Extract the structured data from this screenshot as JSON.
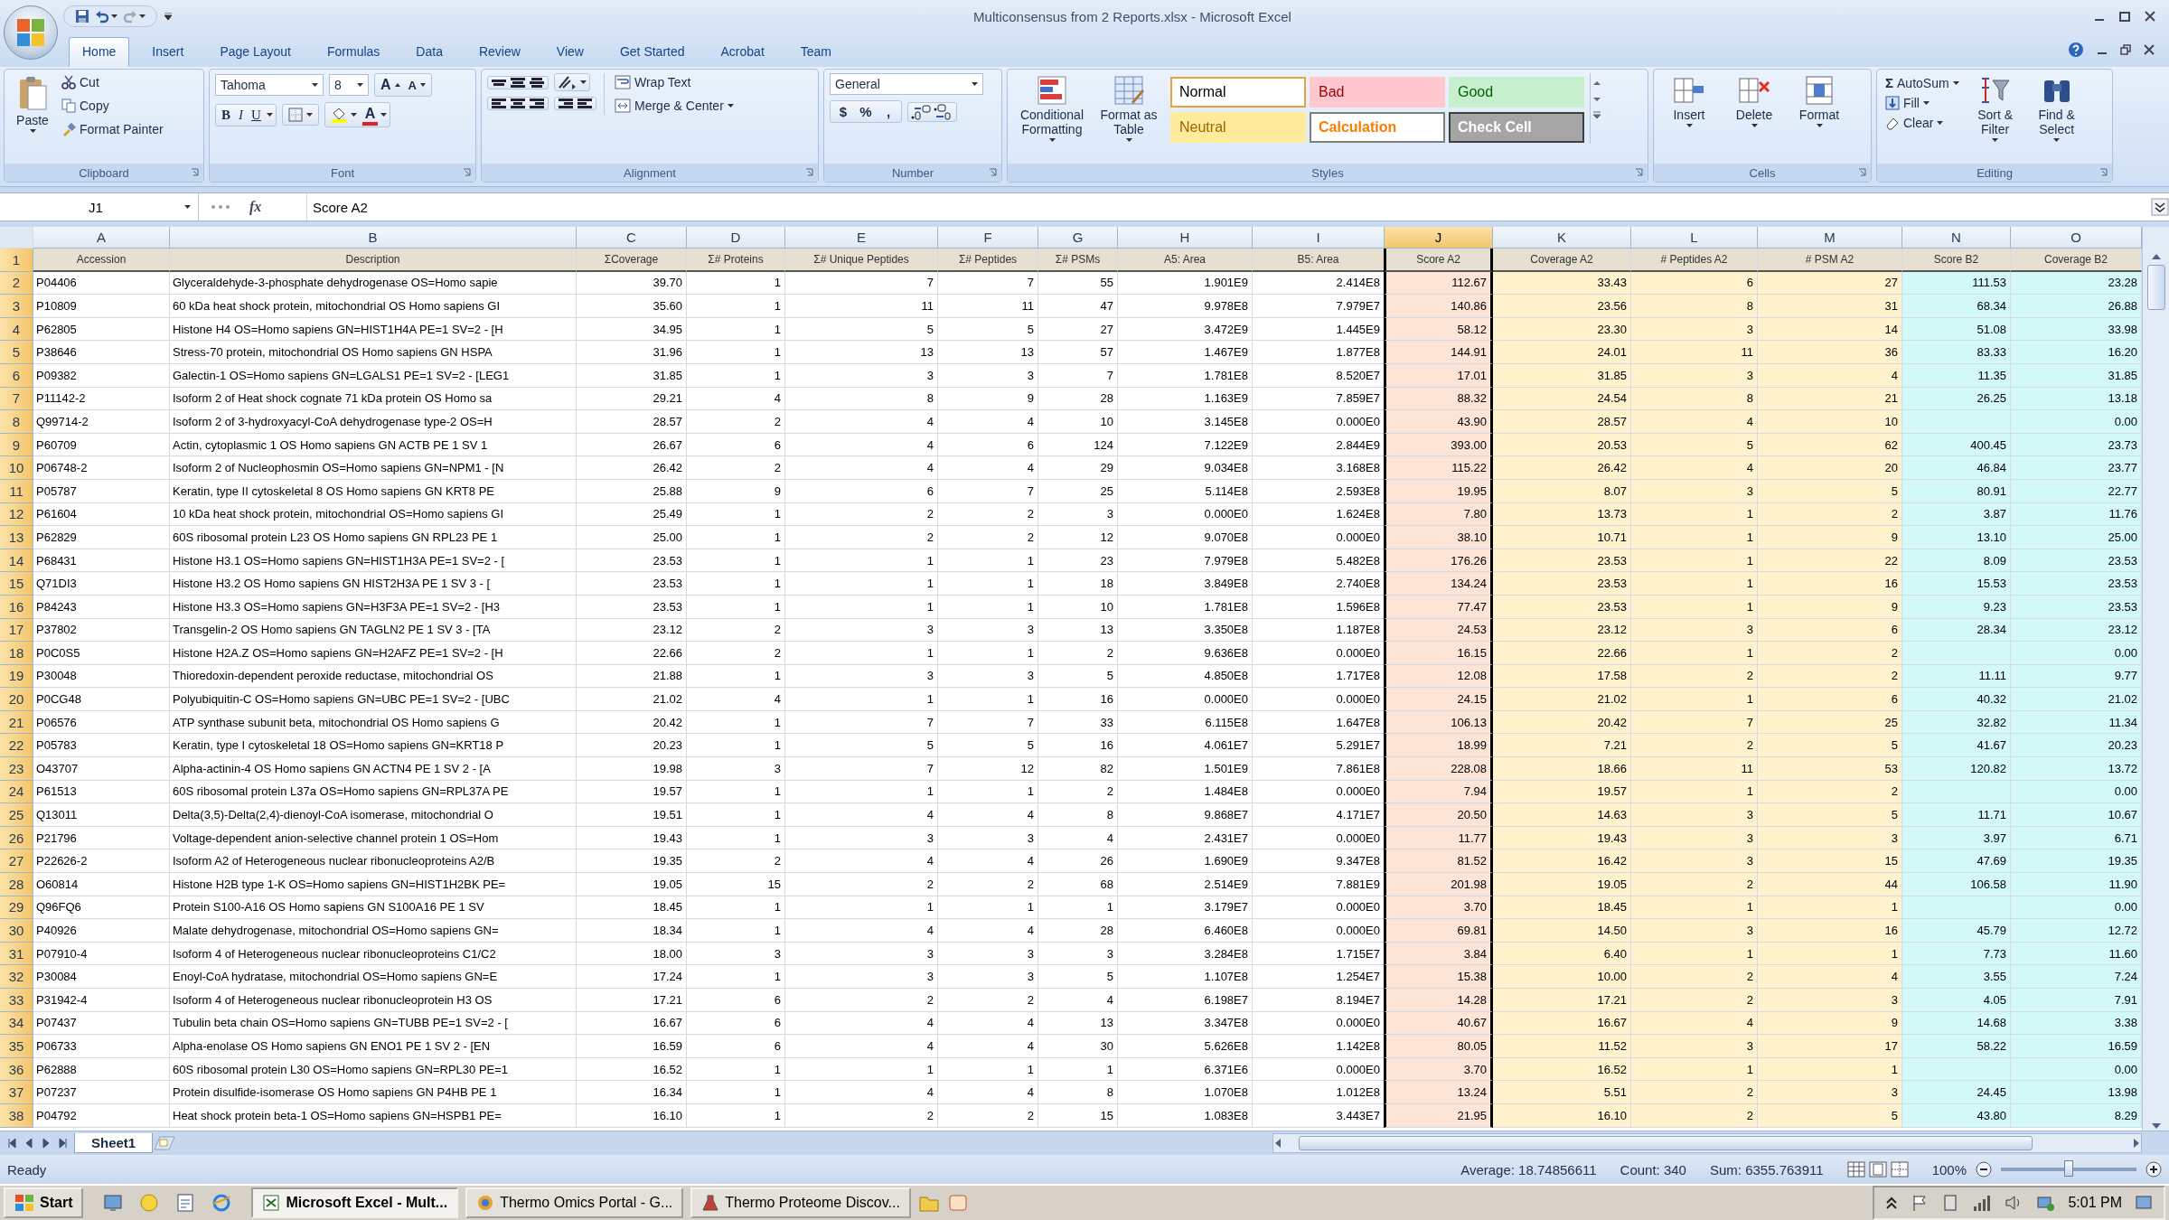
{
  "window": {
    "title": "Multiconsensus from 2 Reports.xlsx - Microsoft Excel"
  },
  "tabs": [
    {
      "label": "Home",
      "selected": true
    },
    {
      "label": "Insert",
      "selected": false
    },
    {
      "label": "Page Layout",
      "selected": false
    },
    {
      "label": "Formulas",
      "selected": false
    },
    {
      "label": "Data",
      "selected": false
    },
    {
      "label": "Review",
      "selected": false
    },
    {
      "label": "View",
      "selected": false
    },
    {
      "label": "Get Started",
      "selected": false
    },
    {
      "label": "Acrobat",
      "selected": false
    },
    {
      "label": "Team",
      "selected": false
    }
  ],
  "ribbon": {
    "clipboard": {
      "title": "Clipboard",
      "paste": "Paste",
      "items": [
        "Cut",
        "Copy",
        "Format Painter"
      ]
    },
    "font": {
      "title": "Font",
      "name": "Tahoma",
      "size": "8",
      "size_buttons": [
        "A",
        "A"
      ],
      "buttons": [
        "B",
        "I",
        "U"
      ],
      "color_button": "A"
    },
    "alignment": {
      "title": "Alignment",
      "wrap": "Wrap Text",
      "merge": "Merge & Center"
    },
    "number": {
      "title": "Number",
      "format": "General",
      "buttons": [
        "$",
        "%",
        ","
      ]
    },
    "styles": {
      "title": "Styles",
      "conditional": "Conditional Formatting",
      "format_table": "Format as Table",
      "cells": [
        {
          "label": "Normal",
          "kind": "normal"
        },
        {
          "label": "Bad",
          "kind": "bad"
        },
        {
          "label": "Good",
          "kind": "good"
        },
        {
          "label": "Neutral",
          "kind": "neutral"
        },
        {
          "label": "Calculation",
          "kind": "calculation"
        },
        {
          "label": "Check Cell",
          "kind": "check"
        }
      ]
    },
    "cells": {
      "title": "Cells",
      "buttons": [
        "Insert",
        "Delete",
        "Format"
      ]
    },
    "editing": {
      "title": "Editing",
      "autosum_symbol": "Σ",
      "items": [
        "AutoSum",
        "Fill",
        "Clear"
      ],
      "buttons": [
        "Sort & Filter",
        "Find & Select"
      ]
    }
  },
  "formula_bar": {
    "name_box": "J1",
    "fx": "fx",
    "content": "Score A2"
  },
  "sheet": {
    "columns": [
      {
        "letter": "A",
        "header": "Accession",
        "selected": false
      },
      {
        "letter": "B",
        "header": "Description",
        "selected": false
      },
      {
        "letter": "C",
        "header": "ΣCoverage",
        "selected": false
      },
      {
        "letter": "D",
        "header": "Σ# Proteins",
        "selected": false
      },
      {
        "letter": "E",
        "header": "Σ# Unique Peptides",
        "selected": false
      },
      {
        "letter": "F",
        "header": "Σ# Peptides",
        "selected": false
      },
      {
        "letter": "G",
        "header": "Σ# PSMs",
        "selected": false
      },
      {
        "letter": "H",
        "header": "A5: Area",
        "selected": false
      },
      {
        "letter": "I",
        "header": "B5: Area",
        "selected": false
      },
      {
        "letter": "J",
        "header": "Score A2",
        "selected": true,
        "color": "#fce4d6"
      },
      {
        "letter": "K",
        "header": "Coverage A2",
        "selected": false,
        "color": "#fff2cc"
      },
      {
        "letter": "L",
        "header": "# Peptides A2",
        "selected": false,
        "color": "#fff2cc"
      },
      {
        "letter": "M",
        "header": "# PSM A2",
        "selected": false,
        "color": "#fff2cc"
      },
      {
        "letter": "N",
        "header": "Score B2",
        "selected": false,
        "color": "#d2f8f8"
      },
      {
        "letter": "O",
        "header": "Coverage B2",
        "selected": false,
        "color": "#d2f8f8"
      }
    ],
    "header_row": "1",
    "rows": [
      {
        "number": "2",
        "cells": [
          "P04406",
          "Glyceraldehyde-3-phosphate dehydrogenase OS=Homo sapie",
          "39.70",
          "1",
          "7",
          "7",
          "55",
          "1.901E9",
          "2.414E8",
          "112.67",
          "33.43",
          "6",
          "27",
          "111.53",
          "23.28"
        ]
      },
      {
        "number": "3",
        "cells": [
          "P10809",
          "60 kDa heat shock protein, mitochondrial OS  Homo sapiens GI",
          "35.60",
          "1",
          "11",
          "11",
          "47",
          "9.978E8",
          "7.979E7",
          "140.86",
          "23.56",
          "8",
          "31",
          "68.34",
          "26.88"
        ]
      },
      {
        "number": "4",
        "cells": [
          "P62805",
          "Histone H4 OS=Homo sapiens GN=HIST1H4A PE=1 SV=2 - [H",
          "34.95",
          "1",
          "5",
          "5",
          "27",
          "3.472E9",
          "1.445E9",
          "58.12",
          "23.30",
          "3",
          "14",
          "51.08",
          "33.98"
        ]
      },
      {
        "number": "5",
        "cells": [
          "P38646",
          "Stress-70 protein, mitochondrial OS  Homo sapiens GN  HSPA",
          "31.96",
          "1",
          "13",
          "13",
          "57",
          "1.467E9",
          "1.877E8",
          "144.91",
          "24.01",
          "11",
          "36",
          "83.33",
          "16.20"
        ]
      },
      {
        "number": "6",
        "cells": [
          "P09382",
          "Galectin-1 OS=Homo sapiens GN=LGALS1 PE=1 SV=2 - [LEG1",
          "31.85",
          "1",
          "3",
          "3",
          "7",
          "1.781E8",
          "8.520E7",
          "17.01",
          "31.85",
          "3",
          "4",
          "11.35",
          "31.85"
        ]
      },
      {
        "number": "7",
        "cells": [
          "P11142-2",
          "Isoform 2 of Heat shock cognate 71 kDa protein OS  Homo sa",
          "29.21",
          "4",
          "8",
          "9",
          "28",
          "1.163E9",
          "7.859E7",
          "88.32",
          "24.54",
          "8",
          "21",
          "26.25",
          "13.18"
        ]
      },
      {
        "number": "8",
        "cells": [
          "Q99714-2",
          "Isoform 2 of 3-hydroxyacyl-CoA dehydrogenase type-2 OS=H",
          "28.57",
          "2",
          "4",
          "4",
          "10",
          "3.145E8",
          "0.000E0",
          "43.90",
          "28.57",
          "4",
          "10",
          null,
          "0.00"
        ]
      },
      {
        "number": "9",
        "cells": [
          "P60709",
          "Actin, cytoplasmic 1 OS  Homo sapiens GN  ACTB PE  1 SV  1",
          "26.67",
          "6",
          "4",
          "6",
          "124",
          "7.122E9",
          "2.844E9",
          "393.00",
          "20.53",
          "5",
          "62",
          "400.45",
          "23.73"
        ]
      },
      {
        "number": "10",
        "cells": [
          "P06748-2",
          "Isoform 2 of Nucleophosmin OS=Homo sapiens GN=NPM1 - [N",
          "26.42",
          "2",
          "4",
          "4",
          "29",
          "9.034E8",
          "3.168E8",
          "115.22",
          "26.42",
          "4",
          "20",
          "46.84",
          "23.77"
        ]
      },
      {
        "number": "11",
        "cells": [
          "P05787",
          "Keratin, type II cytoskeletal 8 OS  Homo sapiens GN  KRT8 PE",
          "25.88",
          "9",
          "6",
          "7",
          "25",
          "5.114E8",
          "2.593E8",
          "19.95",
          "8.07",
          "3",
          "5",
          "80.91",
          "22.77"
        ]
      },
      {
        "number": "12",
        "cells": [
          "P61604",
          "10 kDa heat shock protein, mitochondrial OS=Homo sapiens GI",
          "25.49",
          "1",
          "2",
          "2",
          "3",
          "0.000E0",
          "1.624E8",
          "7.80",
          "13.73",
          "1",
          "2",
          "3.87",
          "11.76"
        ]
      },
      {
        "number": "13",
        "cells": [
          "P62829",
          "60S ribosomal protein L23 OS  Homo sapiens GN  RPL23 PE  1",
          "25.00",
          "1",
          "2",
          "2",
          "12",
          "9.070E8",
          "0.000E0",
          "38.10",
          "10.71",
          "1",
          "9",
          "13.10",
          "25.00"
        ]
      },
      {
        "number": "14",
        "cells": [
          "P68431",
          "Histone H3.1 OS=Homo sapiens GN=HIST1H3A PE=1 SV=2 - [",
          "23.53",
          "1",
          "1",
          "1",
          "23",
          "7.979E8",
          "5.482E8",
          "176.26",
          "23.53",
          "1",
          "22",
          "8.09",
          "23.53"
        ]
      },
      {
        "number": "15",
        "cells": [
          "Q71DI3",
          "Histone H3.2 OS  Homo sapiens GN  HIST2H3A PE  1 SV  3 - [",
          "23.53",
          "1",
          "1",
          "1",
          "18",
          "3.849E8",
          "2.740E8",
          "134.24",
          "23.53",
          "1",
          "16",
          "15.53",
          "23.53"
        ]
      },
      {
        "number": "16",
        "cells": [
          "P84243",
          "Histone H3.3 OS=Homo sapiens GN=H3F3A PE=1 SV=2 - [H3",
          "23.53",
          "1",
          "1",
          "1",
          "10",
          "1.781E8",
          "1.596E8",
          "77.47",
          "23.53",
          "1",
          "9",
          "9.23",
          "23.53"
        ]
      },
      {
        "number": "17",
        "cells": [
          "P37802",
          "Transgelin-2 OS  Homo sapiens GN  TAGLN2 PE  1 SV  3 - [TA",
          "23.12",
          "2",
          "3",
          "3",
          "13",
          "3.350E8",
          "1.187E8",
          "24.53",
          "23.12",
          "3",
          "6",
          "28.34",
          "23.12"
        ]
      },
      {
        "number": "18",
        "cells": [
          "P0C0S5",
          "Histone H2A.Z OS=Homo sapiens GN=H2AFZ PE=1 SV=2 - [H",
          "22.66",
          "2",
          "1",
          "1",
          "2",
          "9.636E8",
          "0.000E0",
          "16.15",
          "22.66",
          "1",
          "2",
          null,
          "0.00"
        ]
      },
      {
        "number": "19",
        "cells": [
          "P30048",
          "Thioredoxin-dependent peroxide reductase, mitochondrial OS",
          "21.88",
          "1",
          "3",
          "3",
          "5",
          "4.850E8",
          "1.717E8",
          "12.08",
          "17.58",
          "2",
          "2",
          "11.11",
          "9.77"
        ]
      },
      {
        "number": "20",
        "cells": [
          "P0CG48",
          "Polyubiquitin-C OS=Homo sapiens GN=UBC PE=1 SV=2 - [UBC",
          "21.02",
          "4",
          "1",
          "1",
          "16",
          "0.000E0",
          "0.000E0",
          "24.15",
          "21.02",
          "1",
          "6",
          "40.32",
          "21.02"
        ]
      },
      {
        "number": "21",
        "cells": [
          "P06576",
          "ATP synthase subunit beta, mitochondrial OS  Homo sapiens G",
          "20.42",
          "1",
          "7",
          "7",
          "33",
          "6.115E8",
          "1.647E8",
          "106.13",
          "20.42",
          "7",
          "25",
          "32.82",
          "11.34"
        ]
      },
      {
        "number": "22",
        "cells": [
          "P05783",
          "Keratin, type I cytoskeletal 18 OS=Homo sapiens GN=KRT18 P",
          "20.23",
          "1",
          "5",
          "5",
          "16",
          "4.061E7",
          "5.291E7",
          "18.99",
          "7.21",
          "2",
          "5",
          "41.67",
          "20.23"
        ]
      },
      {
        "number": "23",
        "cells": [
          "O43707",
          "Alpha-actinin-4 OS  Homo sapiens GN  ACTN4 PE  1 SV  2 - [A",
          "19.98",
          "3",
          "7",
          "12",
          "82",
          "1.501E9",
          "7.861E8",
          "228.08",
          "18.66",
          "11",
          "53",
          "120.82",
          "13.72"
        ]
      },
      {
        "number": "24",
        "cells": [
          "P61513",
          "60S ribosomal protein L37a OS=Homo sapiens GN=RPL37A PE",
          "19.57",
          "1",
          "1",
          "1",
          "2",
          "1.484E8",
          "0.000E0",
          "7.94",
          "19.57",
          "1",
          "2",
          null,
          "0.00"
        ]
      },
      {
        "number": "25",
        "cells": [
          "Q13011",
          "Delta(3,5)-Delta(2,4)-dienoyl-CoA isomerase, mitochondrial O",
          "19.51",
          "1",
          "4",
          "4",
          "8",
          "9.868E7",
          "4.171E7",
          "20.50",
          "14.63",
          "3",
          "5",
          "11.71",
          "10.67"
        ]
      },
      {
        "number": "26",
        "cells": [
          "P21796",
          "Voltage-dependent anion-selective channel protein 1 OS=Hom",
          "19.43",
          "1",
          "3",
          "3",
          "4",
          "2.431E7",
          "0.000E0",
          "11.77",
          "19.43",
          "3",
          "3",
          "3.97",
          "6.71"
        ]
      },
      {
        "number": "27",
        "cells": [
          "P22626-2",
          "Isoform A2 of Heterogeneous nuclear ribonucleoproteins A2/B",
          "19.35",
          "2",
          "4",
          "4",
          "26",
          "1.690E9",
          "9.347E8",
          "81.52",
          "16.42",
          "3",
          "15",
          "47.69",
          "19.35"
        ]
      },
      {
        "number": "28",
        "cells": [
          "O60814",
          "Histone H2B type 1-K OS=Homo sapiens GN=HIST1H2BK PE=",
          "19.05",
          "15",
          "2",
          "2",
          "68",
          "2.514E9",
          "7.881E9",
          "201.98",
          "19.05",
          "2",
          "44",
          "106.58",
          "11.90"
        ]
      },
      {
        "number": "29",
        "cells": [
          "Q96FQ6",
          "Protein S100-A16 OS  Homo sapiens GN  S100A16 PE  1 SV",
          "18.45",
          "1",
          "1",
          "1",
          "1",
          "3.179E7",
          "0.000E0",
          "3.70",
          "18.45",
          "1",
          "1",
          null,
          "0.00"
        ]
      },
      {
        "number": "30",
        "cells": [
          "P40926",
          "Malate dehydrogenase, mitochondrial OS=Homo sapiens GN=",
          "18.34",
          "1",
          "4",
          "4",
          "28",
          "6.460E8",
          "0.000E0",
          "69.81",
          "14.50",
          "3",
          "16",
          "45.79",
          "12.72"
        ]
      },
      {
        "number": "31",
        "cells": [
          "P07910-4",
          "Isoform 4 of Heterogeneous nuclear ribonucleoproteins C1/C2",
          "18.00",
          "3",
          "3",
          "3",
          "3",
          "3.284E8",
          "1.715E7",
          "3.84",
          "6.40",
          "1",
          "1",
          "7.73",
          "11.60"
        ]
      },
      {
        "number": "32",
        "cells": [
          "P30084",
          "Enoyl-CoA hydratase, mitochondrial OS=Homo sapiens GN=E",
          "17.24",
          "1",
          "3",
          "3",
          "5",
          "1.107E8",
          "1.254E7",
          "15.38",
          "10.00",
          "2",
          "4",
          "3.55",
          "7.24"
        ]
      },
      {
        "number": "33",
        "cells": [
          "P31942-4",
          "Isoform 4 of Heterogeneous nuclear ribonucleoprotein H3 OS",
          "17.21",
          "6",
          "2",
          "2",
          "4",
          "6.198E7",
          "8.194E7",
          "14.28",
          "17.21",
          "2",
          "3",
          "4.05",
          "7.91"
        ]
      },
      {
        "number": "34",
        "cells": [
          "P07437",
          "Tubulin beta chain OS=Homo sapiens GN=TUBB PE=1 SV=2 - [",
          "16.67",
          "6",
          "4",
          "4",
          "13",
          "3.347E8",
          "0.000E0",
          "40.67",
          "16.67",
          "4",
          "9",
          "14.68",
          "3.38"
        ]
      },
      {
        "number": "35",
        "cells": [
          "P06733",
          "Alpha-enolase OS  Homo sapiens GN  ENO1 PE  1 SV  2 - [EN",
          "16.59",
          "6",
          "4",
          "4",
          "30",
          "5.626E8",
          "1.142E8",
          "80.05",
          "11.52",
          "3",
          "17",
          "58.22",
          "16.59"
        ]
      },
      {
        "number": "36",
        "cells": [
          "P62888",
          "60S ribosomal protein L30 OS=Homo sapiens GN=RPL30 PE=1",
          "16.52",
          "1",
          "1",
          "1",
          "1",
          "6.371E6",
          "0.000E0",
          "3.70",
          "16.52",
          "1",
          "1",
          null,
          "0.00"
        ]
      },
      {
        "number": "37",
        "cells": [
          "P07237",
          "Protein disulfide-isomerase OS  Homo sapiens GN  P4HB PE  1",
          "16.34",
          "1",
          "4",
          "4",
          "8",
          "1.070E8",
          "1.012E8",
          "13.24",
          "5.51",
          "2",
          "3",
          "24.45",
          "13.98"
        ]
      },
      {
        "number": "38",
        "cells": [
          "P04792",
          "Heat shock protein beta-1 OS=Homo sapiens GN=HSPB1 PE=",
          "16.10",
          "1",
          "2",
          "2",
          "15",
          "1.083E8",
          "3.443E7",
          "21.95",
          "16.10",
          "2",
          "5",
          "43.80",
          "8.29"
        ]
      }
    ]
  },
  "sheet_tabs": [
    {
      "label": "Sheet1",
      "selected": true
    }
  ],
  "status": {
    "mode": "Ready",
    "average": "Average: 18.74856611",
    "count": "Count: 340",
    "sum": "Sum: 6355.763911",
    "zoom": "100%",
    "zoom_slider": {
      "level": 0.5
    }
  },
  "taskbar": {
    "start": "Start",
    "tasks": [
      {
        "label": "Microsoft Excel - Mult...",
        "selected": true
      },
      {
        "label": "Thermo Omics Portal - G...",
        "selected": false
      },
      {
        "label": "Thermo Proteome Discov...",
        "selected": false
      }
    ],
    "clock": "5:01 PM"
  }
}
